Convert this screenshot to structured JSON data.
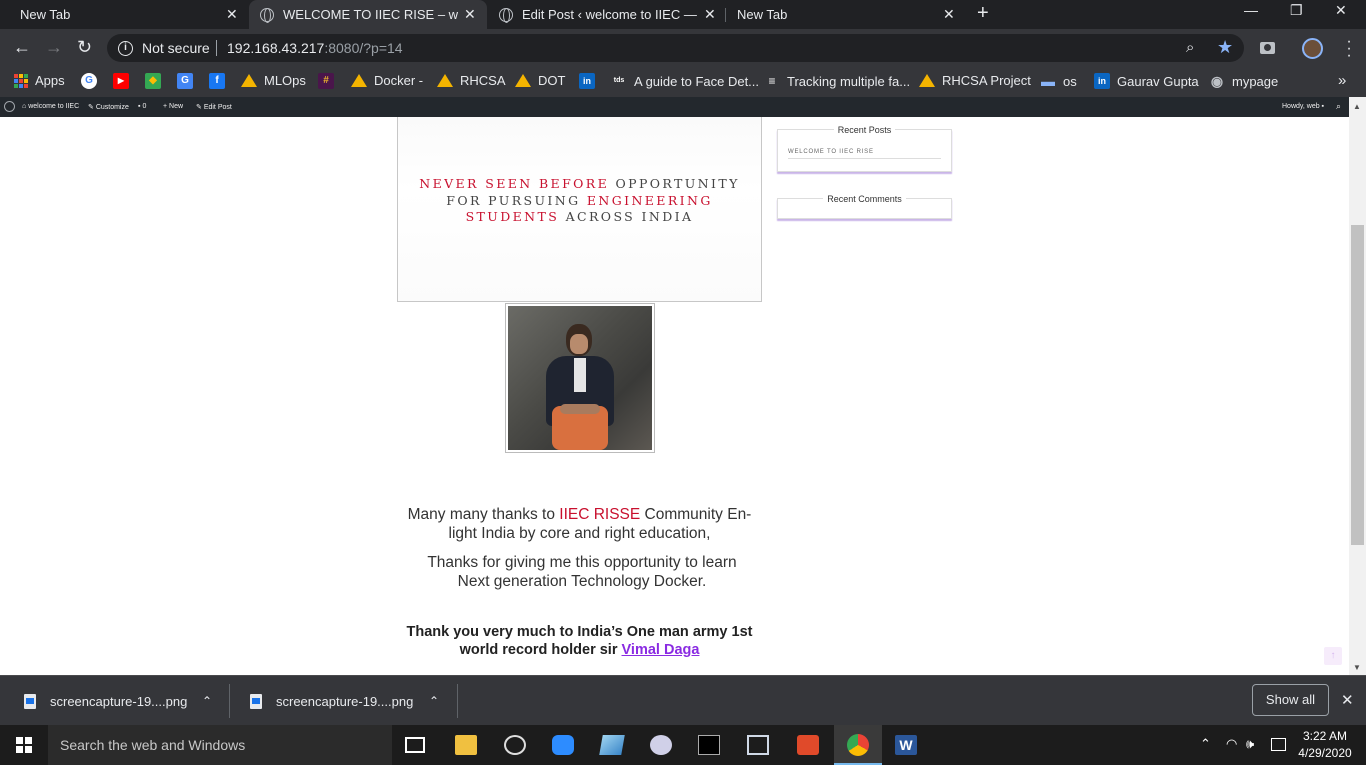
{
  "browser": {
    "tabs": [
      {
        "title": "New Tab",
        "active": false
      },
      {
        "title": "WELCOME TO IIEC RISE – welcom",
        "active": true
      },
      {
        "title": "Edit Post ‹ welcome to IIEC — Wo",
        "active": false
      },
      {
        "title": "New Tab",
        "active": false
      }
    ],
    "close_glyph": "✕",
    "new_tab_glyph": "+",
    "window_controls": {
      "minimize": "—",
      "restore": "❐",
      "close": "✕"
    }
  },
  "toolbar": {
    "back": "←",
    "forward": "→",
    "reload": "↻",
    "security_label": "Not secure",
    "url_host": "192.168.43.217",
    "url_rest": ":8080/?p=14",
    "zoom_icon": "⌕",
    "bookmark_star": "★",
    "menu": "⋮"
  },
  "bookmarks": {
    "items": [
      {
        "label": "Apps",
        "icon": "apps-grid-icon"
      },
      {
        "label": "",
        "icon": "google-icon",
        "glyph": "G",
        "color": "#ffffff",
        "text_color": "#4285f4"
      },
      {
        "label": "",
        "icon": "youtube-icon",
        "glyph": "▶",
        "color": "#ff0000",
        "text_color": "#ffffff"
      },
      {
        "label": "",
        "icon": "maps-icon",
        "glyph": "◆",
        "color": "#34a853",
        "text_color": "#fbbc04"
      },
      {
        "label": "",
        "icon": "translate-icon",
        "glyph": "G",
        "color": "#4285f4",
        "text_color": "#ffffff"
      },
      {
        "label": "",
        "icon": "facebook-icon",
        "glyph": "f",
        "color": "#1877f2",
        "text_color": "#ffffff"
      },
      {
        "label": "MLOps",
        "icon": "drive-icon"
      },
      {
        "label": "",
        "icon": "slack-icon",
        "glyph": "#",
        "color": "#4a154b",
        "text_color": "#ecb22e"
      },
      {
        "label": "Docker -",
        "icon": "drive-icon"
      },
      {
        "label": "RHCSA",
        "icon": "drive-icon"
      },
      {
        "label": "DOT",
        "icon": "drive-icon"
      },
      {
        "label": "",
        "icon": "linkedin-icon",
        "glyph": "in",
        "color": "#0a66c2",
        "text_color": "#ffffff"
      },
      {
        "label": "A guide to Face Det...",
        "icon": "tds-icon",
        "glyph": "tds",
        "color": "#35363a",
        "text_color": "#e8eaed"
      },
      {
        "label": "Tracking multiple fa...",
        "icon": "list-icon",
        "glyph": "≡",
        "color": "#35363a",
        "text_color": "#e8eaed"
      },
      {
        "label": "RHCSA Project",
        "icon": "drive-icon"
      },
      {
        "label": "os",
        "icon": "monitor-icon",
        "glyph": "▬",
        "color": "#35363a",
        "text_color": "#8ab4f8"
      },
      {
        "label": "Gaurav Gupta",
        "icon": "linkedin-icon",
        "glyph": "in",
        "color": "#0a66c2",
        "text_color": "#ffffff"
      },
      {
        "label": "mypage",
        "icon": "globe-icon",
        "glyph": "◉",
        "color": "#35363a",
        "text_color": "#bdc1c6"
      }
    ],
    "more": "»"
  },
  "wp_admin_bar": {
    "site": "welcome to IIEC",
    "customize": "Customize",
    "comments": "0",
    "new": "New",
    "edit_post": "Edit Post",
    "howdy": "Howdy, web"
  },
  "post": {
    "banner": {
      "line1_red": "NEVER SEEN BEFORE",
      "line1_rest": " OPPORTUNITY",
      "line2_plain": "FOR PURSUING ",
      "line2_red": "ENGINEERING",
      "line3_red": "STUDENTS",
      "line3_rest": " ACROSS INDIA"
    },
    "para1_pre": "Many many  thanks to ",
    "para1_red": "IIEC  RISSE",
    "para1_post": " Community En-light India  by core and right education,",
    "para2": "Thanks for giving me this opportunity  to learn Next generation Technology Docker.",
    "para3_pre": "Thank you very much to India’s One man army  1st world record holder sir ",
    "para3_link": "Vimal  Daga"
  },
  "sidebar": {
    "recent_posts_title": "Recent Posts",
    "recent_post_link": "WELCOME TO IIEC RISE",
    "recent_comments_title": "Recent Comments"
  },
  "downloads": {
    "items": [
      {
        "name": "screencapture-19....png"
      },
      {
        "name": "screencapture-19....png"
      }
    ],
    "show_all": "Show all",
    "close": "✕",
    "chevron": "⌃"
  },
  "taskbar": {
    "search_placeholder": "Search the web and Windows",
    "time": "3:22 AM",
    "date": "4/29/2020",
    "tray_up": "⌃"
  },
  "colors": {
    "chrome_dark": "#202124",
    "chrome_toolbar": "#35363a",
    "accent_red": "#c8102e",
    "link_purple": "#8a2be2"
  }
}
